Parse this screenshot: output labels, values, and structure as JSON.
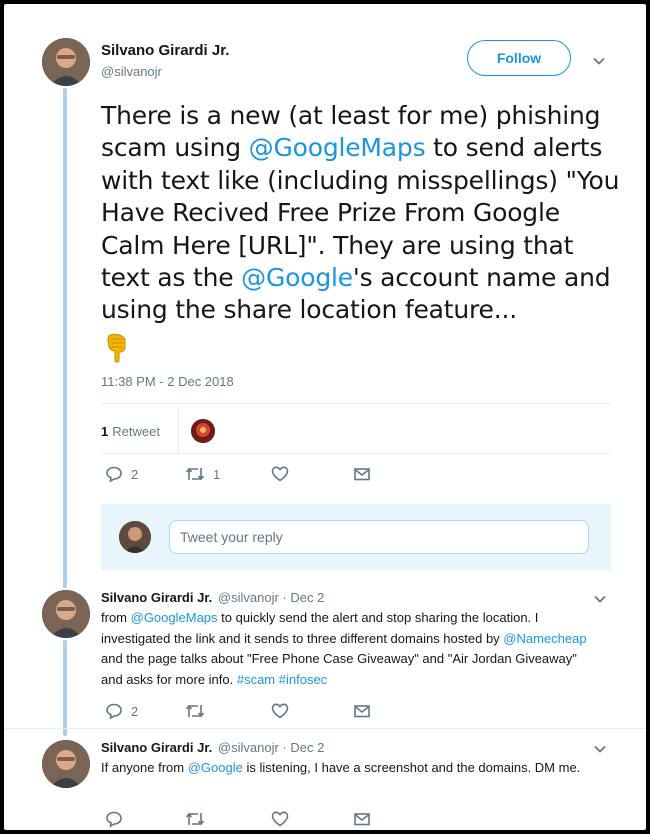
{
  "main_tweet": {
    "author_name": "Silvano Girardi Jr.",
    "author_handle": "@silvanojr",
    "follow_label": "Follow",
    "text_part1": "There is a new (at least for me) phishing scam using ",
    "mention1": "@GoogleMaps",
    "text_part2": " to send alerts with text like (including misspellings) \"You Have Recived Free Prize From Google Calm Here [URL]\". They are using that text as the ",
    "mention2": "@Google",
    "text_part3": "'s account name and using the share location feature...",
    "emoji_icon": "backhand-index-pointing-down",
    "timestamp": "11:38 PM - 2 Dec 2018",
    "retweet_count": "1",
    "retweet_label": "Retweet",
    "reply_count": "2",
    "retweet_action_count": "1"
  },
  "reply_box": {
    "placeholder": "Tweet your reply"
  },
  "replies": [
    {
      "author_name": "Silvano Girardi Jr.",
      "handle_date": "@silvanojr · Dec 2",
      "t1": "from ",
      "m1": "@GoogleMaps",
      "t2": " to quickly send the alert and stop sharing the location. I investigated the link and it sends to three different domains hosted by ",
      "m2": "@Namecheap",
      "t3": " and the page talks about \"Free Phone Case Giveaway\" and \"Air Jordan Giveaway\" and asks for more info. ",
      "h1": "#scam",
      "h2": "#infosec",
      "reply_count": "2"
    },
    {
      "author_name": "Silvano Girardi Jr.",
      "handle_date": "@silvanojr · Dec 2",
      "t1": "If anyone from ",
      "m1": "@Google",
      "t2": " is listening, I have a screenshot and the domains. DM me."
    }
  ],
  "colors": {
    "accent": "#1b95e0",
    "thread_line": "#a7d0ec",
    "reply_bg": "#e8f5fd",
    "muted": "#657786"
  }
}
